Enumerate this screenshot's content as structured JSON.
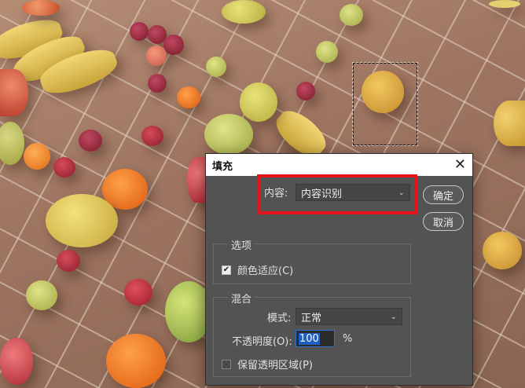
{
  "dialog": {
    "title": "填充",
    "close_icon": "close-icon",
    "content_label": "内容:",
    "content_value": "内容识别",
    "ok_label": "确定",
    "cancel_label": "取消",
    "options_group": "选项",
    "color_adapt_label": "颜色适应(C)",
    "color_adapt_checked": true,
    "blend_group": "混合",
    "mode_label": "模式:",
    "mode_value": "正常",
    "opacity_label": "不透明度(O):",
    "opacity_value": "100",
    "opacity_unit": "%",
    "preserve_label": "保留透明区域(P)",
    "preserve_checked": false
  },
  "colors": {
    "highlight": "#e5141a",
    "dialog_bg": "#535353",
    "accent": "#2a73d4"
  }
}
